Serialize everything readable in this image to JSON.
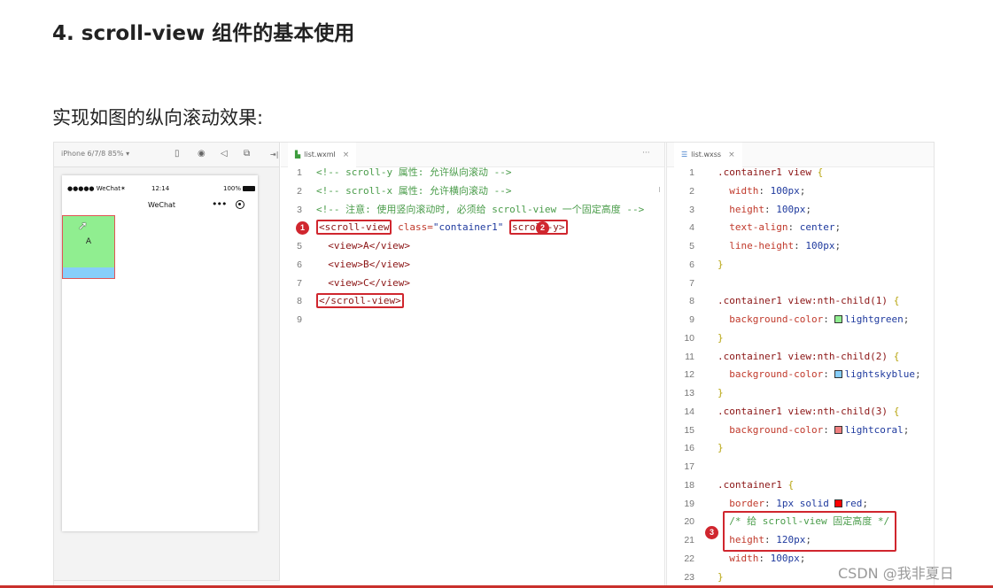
{
  "heading": "4. scroll-view 组件的基本使用",
  "subheading": "实现如图的纵向滚动效果:",
  "simulator": {
    "device": "iPhone 6/7/8 85% ▾",
    "status_left": "●●●●● WeChat✶",
    "status_time": "12:14",
    "status_battery": "100%",
    "nav_title": "WeChat",
    "capsule_dots": "•••",
    "box_a_label": "A"
  },
  "editor_wxml": {
    "tab_label": "list.wxml",
    "tab_close": "×",
    "lines": [
      {
        "n": "1",
        "comment": "<!-- scroll-y 属性: 允许纵向滚动 -->"
      },
      {
        "n": "2",
        "comment": "<!-- scroll-x 属性: 允许横向滚动 -->"
      },
      {
        "n": "3",
        "comment": "<!-- 注意: 使用竖向滚动时, 必须给 scroll-view 一个固定高度 -->"
      },
      {
        "n": "4",
        "open_tag": "<scroll-view",
        "attr": " class=",
        "value": "\"container1\"",
        "attr2": "scroll-y>"
      },
      {
        "n": "5",
        "text": "  <view>A</view>"
      },
      {
        "n": "6",
        "text": "  <view>B</view>"
      },
      {
        "n": "7",
        "text": "  <view>C</view>"
      },
      {
        "n": "8",
        "close_tag": "</scroll-view>"
      },
      {
        "n": "9",
        "text": ""
      }
    ],
    "badges": [
      "1",
      "2"
    ]
  },
  "editor_wxss": {
    "tab_label": "list.wxss",
    "tab_close": "×",
    "more": "···",
    "lines": [
      {
        "n": "1",
        "sel": ".container1 view ",
        "brace": "{"
      },
      {
        "n": "2",
        "prop": "width",
        "val": "100px"
      },
      {
        "n": "3",
        "prop": "height",
        "val": "100px"
      },
      {
        "n": "4",
        "prop": "text-align",
        "val": "center"
      },
      {
        "n": "5",
        "prop": "line-height",
        "val": "100px"
      },
      {
        "n": "6",
        "brace": "}"
      },
      {
        "n": "7"
      },
      {
        "n": "8",
        "sel": ".container1 view:nth-child(1) ",
        "brace": "{"
      },
      {
        "n": "9",
        "prop": "background-color",
        "val": "lightgreen",
        "swatch": "#90ee90"
      },
      {
        "n": "10",
        "brace": "}"
      },
      {
        "n": "11",
        "sel": ".container1 view:nth-child(2) ",
        "brace": "{"
      },
      {
        "n": "12",
        "prop": "background-color",
        "val": "lightskyblue",
        "swatch": "#87cefa"
      },
      {
        "n": "13",
        "brace": "}"
      },
      {
        "n": "14",
        "sel": ".container1 view:nth-child(3) ",
        "brace": "{"
      },
      {
        "n": "15",
        "prop": "background-color",
        "val": "lightcoral",
        "swatch": "#f08080"
      },
      {
        "n": "16",
        "brace": "}"
      },
      {
        "n": "17"
      },
      {
        "n": "18",
        "sel": ".container1 ",
        "brace": "{"
      },
      {
        "n": "19",
        "prop": "border",
        "val": "1px solid ",
        "val2": "red",
        "swatch": "#ff0000"
      },
      {
        "n": "20",
        "comment": "/* 给 scroll-view 固定高度 */"
      },
      {
        "n": "21",
        "prop": "height",
        "val": "120px"
      },
      {
        "n": "22",
        "prop": "width",
        "val": "100px"
      },
      {
        "n": "23",
        "brace": "}"
      }
    ],
    "badge": "3"
  },
  "watermark": "CSDN @我非夏日"
}
